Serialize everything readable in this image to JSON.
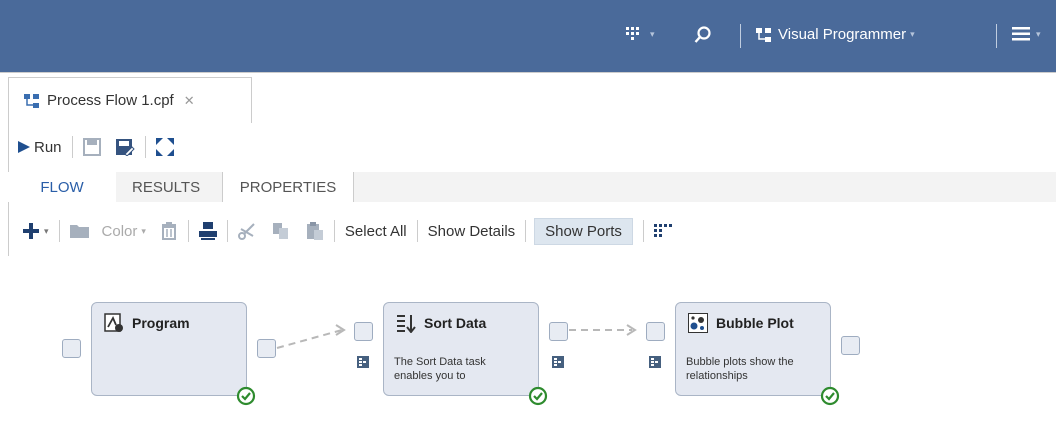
{
  "header": {
    "app_menu_label": "Visual Programmer"
  },
  "tabs": [
    {
      "label": "Process Flow 1.cpf",
      "close": "✕"
    }
  ],
  "toolbar": {
    "run_label": "Run"
  },
  "subtabs": [
    {
      "label": "FLOW"
    },
    {
      "label": "RESULTS"
    },
    {
      "label": "PROPERTIES"
    }
  ],
  "flow_toolbar": {
    "color_label": "Color",
    "select_all": "Select All",
    "show_details": "Show Details",
    "show_ports": "Show Ports"
  },
  "nodes": [
    {
      "title": "Program",
      "description": ""
    },
    {
      "title": "Sort Data",
      "description": "The Sort Data task enables you to"
    },
    {
      "title": "Bubble Plot",
      "description": "Bubble plots show the relationships"
    }
  ],
  "colors": {
    "header_bg": "#4a6a9a",
    "active_tab": "#2a5ea8",
    "node_fill": "#e4e8f1",
    "success": "#2e8b2e"
  }
}
